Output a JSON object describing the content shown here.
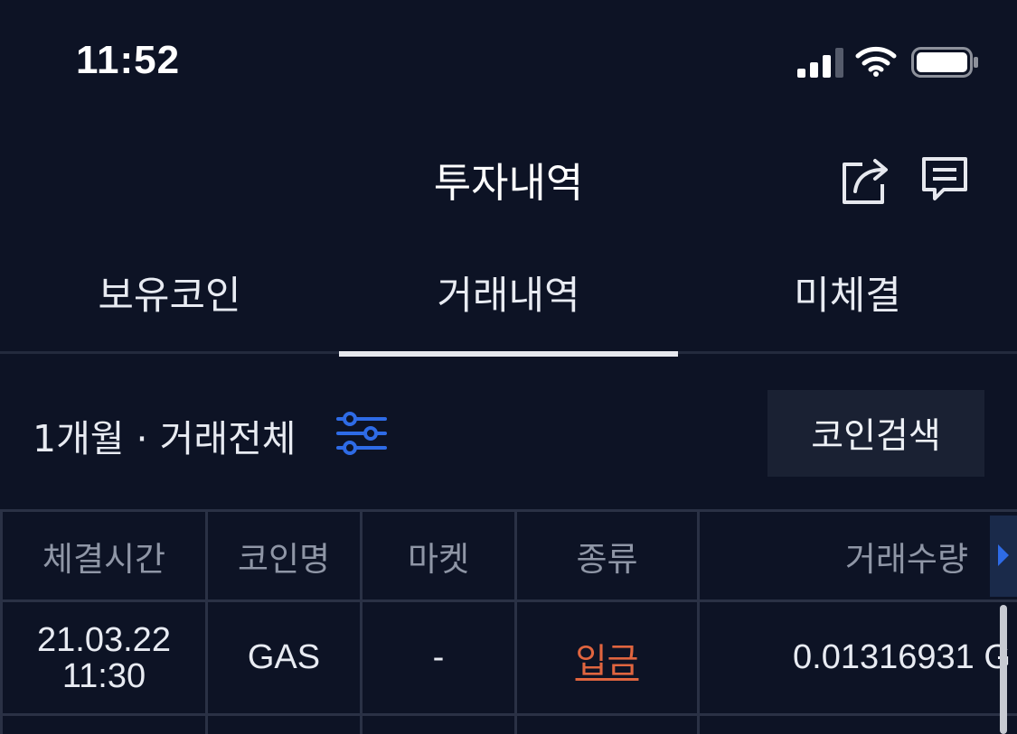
{
  "status_bar": {
    "time": "11:52",
    "icons": [
      "cellular-signal-icon",
      "wifi-icon",
      "battery-icon"
    ]
  },
  "header": {
    "title": "투자내역",
    "actions": [
      "share-icon",
      "chat-icon"
    ]
  },
  "tabs": [
    {
      "label": "보유코인",
      "active": false
    },
    {
      "label": "거래내역",
      "active": true
    },
    {
      "label": "미체결",
      "active": false
    }
  ],
  "filter": {
    "label": "1개월 · 거래전체",
    "icon": "sliders-filter-icon",
    "search_button": "코인검색"
  },
  "table": {
    "columns": [
      "체결시간",
      "코인명",
      "마켓",
      "종류",
      "거래수량"
    ],
    "rows": [
      {
        "date": "21.03.22",
        "time": "11:30",
        "coin": "GAS",
        "market": "-",
        "type": "입금",
        "quantity": "0.01316931 G"
      }
    ]
  },
  "colors": {
    "background": "#0d1325",
    "accent_blue": "#2e6be6",
    "deposit_red": "#e0653f",
    "grid": "#2a3145",
    "search_button_bg": "#1a2133"
  }
}
